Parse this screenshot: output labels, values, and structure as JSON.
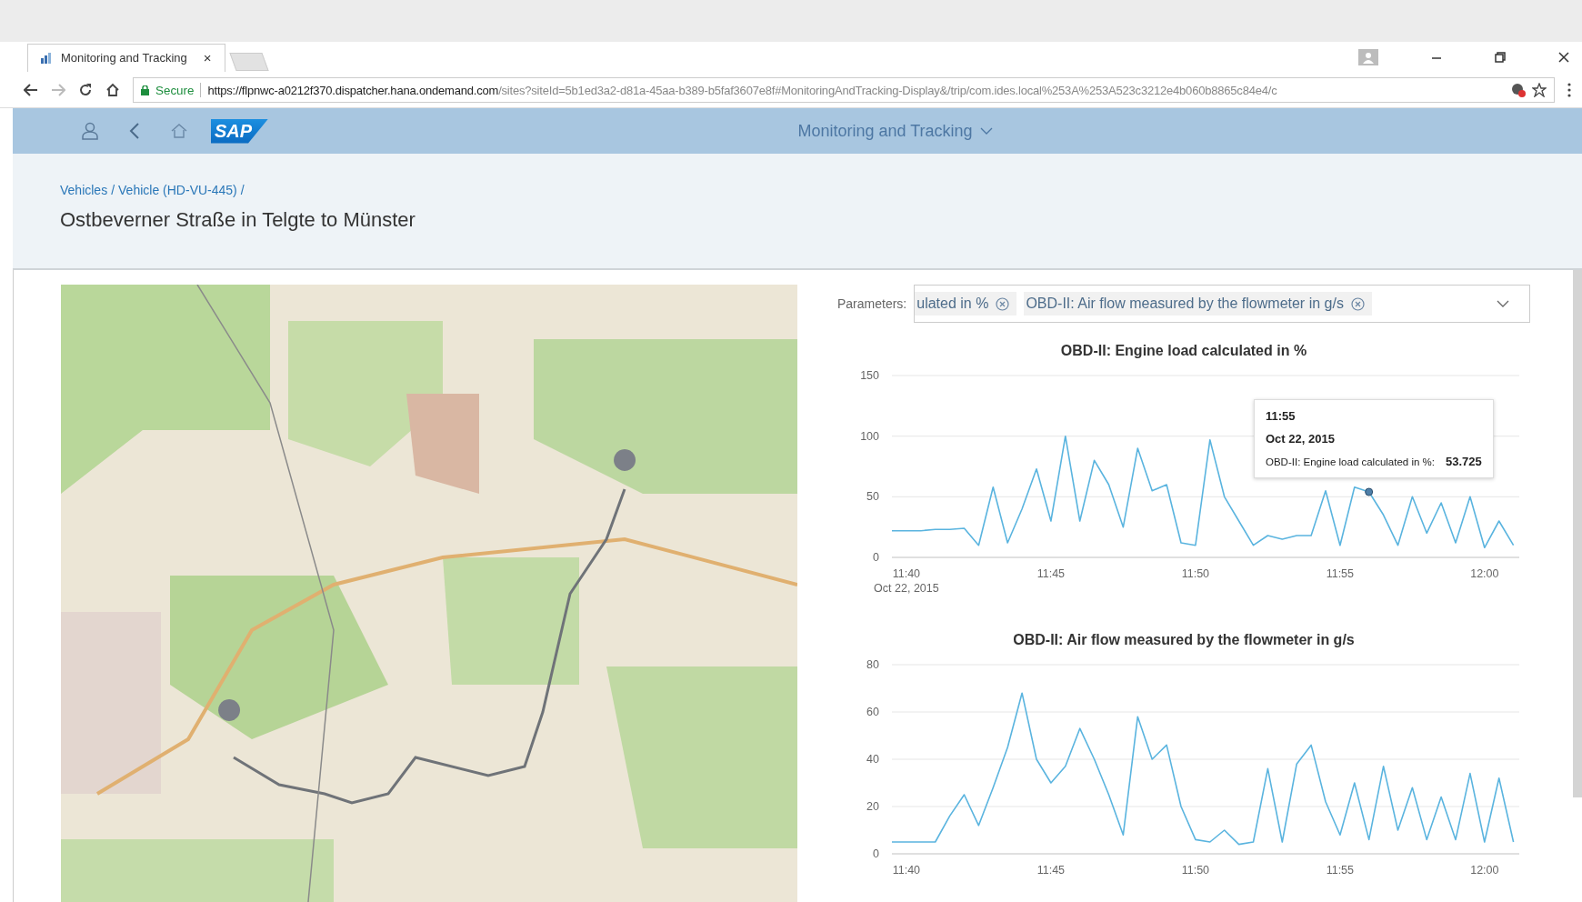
{
  "browser": {
    "tab": {
      "title": "Monitoring and Tracking",
      "close": "×"
    },
    "security": "Secure",
    "url_host": "https://flpnwc-a0212f370.dispatcher.hana.ondemand.com",
    "url_path": "/sites?siteId=5b1ed3a2-d81a-45aa-b389-b5faf3607e8f#MonitoringAndTracking-Display&/trip/com.ides.local%253A%253A523c3212e4b060b8865c84e4/c"
  },
  "shell": {
    "logo": "SAP",
    "title": "Monitoring and Tracking"
  },
  "breadcrumbs": [
    {
      "label": "Vehicles",
      "separator": "/"
    },
    {
      "label": "Vehicle (HD-VU-445)",
      "separator": "/"
    }
  ],
  "page_title": "Ostbeverner Straße in Telgte to Münster",
  "parameters": {
    "label": "Parameters:",
    "tokens": [
      "ulated in %",
      "OBD-II: Air flow measured by the flowmeter in g/s"
    ]
  },
  "charts": [
    {
      "date_label": "Oct 22, 2015",
      "tooltip": {
        "time": "11:55",
        "date": "Oct 22, 2015",
        "series": "OBD-II: Engine load calculated in %:",
        "value": "53.725"
      },
      "chart_data": {
        "type": "line",
        "title": "OBD-II: Engine load calculated in %",
        "categories": [
          null,
          "11:40",
          null,
          null,
          null,
          null,
          null,
          null,
          null,
          null,
          null,
          "11:45",
          null,
          null,
          null,
          null,
          null,
          null,
          null,
          null,
          null,
          "11:50",
          null,
          null,
          null,
          null,
          null,
          null,
          null,
          null,
          null,
          "11:55",
          null,
          null,
          null,
          null,
          null,
          null,
          null,
          null,
          null,
          "12:00",
          null,
          null
        ],
        "series": [
          {
            "color": "#5ab4df",
            "values": [
              22,
              22,
              22,
              23,
              23,
              24,
              10,
              58,
              12,
              40,
              73,
              30,
              100,
              30,
              80,
              60,
              25,
              90,
              55,
              60,
              12,
              10,
              97,
              50,
              30,
              10,
              18,
              15,
              18,
              18,
              55,
              10,
              58,
              54,
              35,
              10,
              50,
              20,
              45,
              12,
              50,
              8,
              30,
              10
            ]
          }
        ],
        "ylim": [
          0,
          150
        ],
        "yticks": [
          0,
          50,
          100,
          150
        ],
        "grid": true
      }
    },
    {
      "chart_data": {
        "type": "line",
        "title": "OBD-II: Air flow measured by the flowmeter in g/s",
        "categories": [
          null,
          "11:40",
          null,
          null,
          null,
          null,
          null,
          null,
          null,
          null,
          null,
          "11:45",
          null,
          null,
          null,
          null,
          null,
          null,
          null,
          null,
          null,
          "11:50",
          null,
          null,
          null,
          null,
          null,
          null,
          null,
          null,
          null,
          "11:55",
          null,
          null,
          null,
          null,
          null,
          null,
          null,
          null,
          null,
          "12:00",
          null,
          null
        ],
        "series": [
          {
            "color": "#5ab4df",
            "values": [
              5,
              5,
              5,
              5,
              16,
              25,
              12,
              28,
              45,
              68,
              40,
              30,
              37,
              53,
              40,
              25,
              8,
              58,
              40,
              46,
              20,
              6,
              5,
              10,
              4,
              5,
              36,
              5,
              38,
              46,
              22,
              8,
              30,
              6,
              37,
              10,
              28,
              6,
              24,
              6,
              34,
              5,
              32,
              5
            ]
          }
        ],
        "ylim": [
          0,
          80
        ],
        "yticks": [
          0,
          20,
          40,
          60,
          80
        ],
        "grid": true
      }
    }
  ]
}
